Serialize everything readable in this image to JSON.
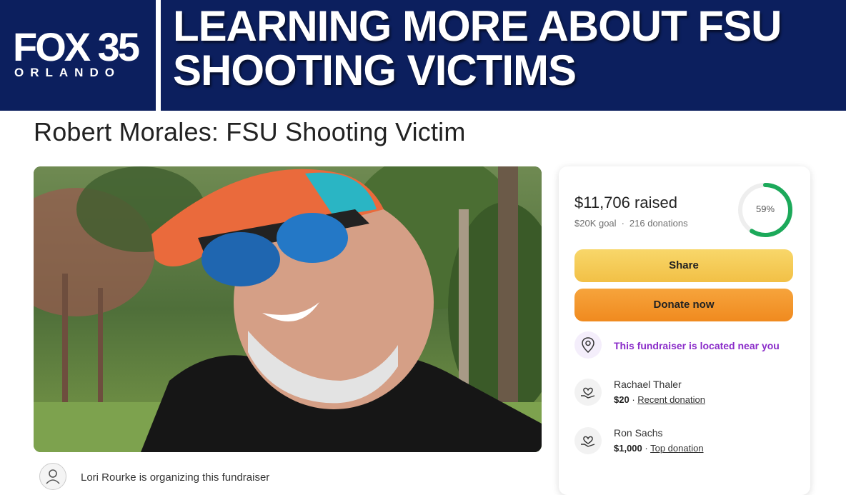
{
  "banner": {
    "logo_main": "FOX 35",
    "logo_sub": "ORLANDO",
    "headline_line1": "LEARNING MORE ABOUT FSU",
    "headline_line2": "SHOOTING VICTIMS"
  },
  "page": {
    "title": "Robert Morales: FSU Shooting Victim",
    "organizer_text": "Lori Rourke is organizing this fundraiser"
  },
  "card": {
    "raised": "$11,706 raised",
    "goal": "$20K goal",
    "donations": "216 donations",
    "progress_label": "59%",
    "progress_fraction": 0.59,
    "share_label": "Share",
    "donate_label": "Donate now",
    "near_text": "This fundraiser is located near you",
    "donations_list": [
      {
        "name": "Rachael Thaler",
        "amount": "$20",
        "tag": "Recent donation"
      },
      {
        "name": "Ron Sachs",
        "amount": "$1,000",
        "tag": "Top donation"
      }
    ]
  },
  "colors": {
    "banner": "#0c1f5e",
    "progress": "#1ca95a",
    "near_text": "#8a2cc9",
    "share": "#f5c94f",
    "donate": "#f39a2c"
  },
  "icons": {
    "location": "location-pin-icon",
    "donation": "heart-hand-icon",
    "organizer": "user-avatar-icon"
  }
}
